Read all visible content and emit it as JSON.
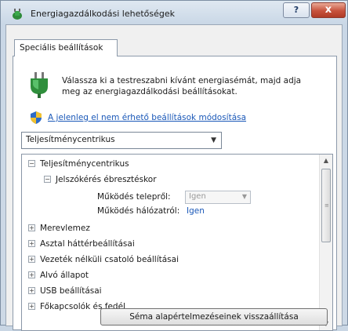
{
  "window": {
    "title": "Energiagazdálkodási lehetőségek",
    "help_label": "?",
    "close_label": "x"
  },
  "tabs": [
    {
      "label": "Speciális beállítások",
      "active": true
    }
  ],
  "intro": {
    "text": "Válassza ki a testreszabni kívánt energiasémát, majd adja meg az energiagazdálkodási beállításokat."
  },
  "settings_link": "A jelenleg el nem érhető beállítások módosítása",
  "plan_select": {
    "value": "Teljesítménycentrikus"
  },
  "tree": {
    "root": "Teljesítménycentrikus",
    "group": "Jelszókérés ébresztéskor",
    "option_battery_label": "Működés telepről:",
    "option_battery_value": "Igen",
    "option_ac_label": "Működés hálózatról:",
    "option_ac_value": "Igen",
    "items": [
      "Merevlemez",
      "Asztal háttérbeállításai",
      "Vezeték nélküli csatoló beállításai",
      "Alvó állapot",
      "USB beállításai",
      "Főkapcsolók és fedél"
    ]
  },
  "restore_button": "Séma alapértelmezéseinek visszaállítása",
  "colors": {
    "link": "#1a58b8",
    "close_button": "#c7523c"
  }
}
